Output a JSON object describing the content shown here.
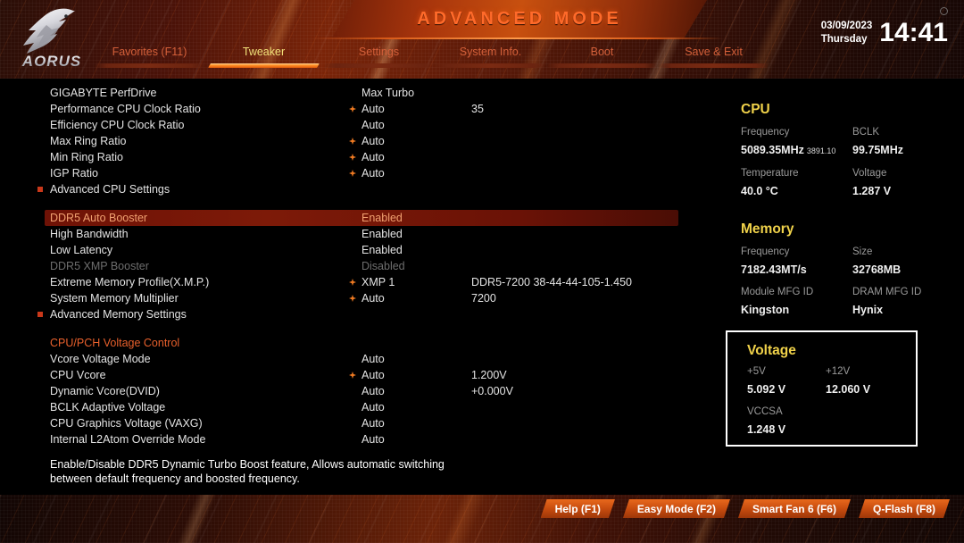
{
  "header": {
    "mode_title": "ADVANCED MODE",
    "logo_text": "AORUS",
    "date": "03/09/2023",
    "weekday": "Thursday",
    "time": "14:41",
    "tabs": [
      {
        "label": "Favorites (F11)",
        "active": false
      },
      {
        "label": "Tweaker",
        "active": true
      },
      {
        "label": "Settings",
        "active": false
      },
      {
        "label": "System Info.",
        "active": false
      },
      {
        "label": "Boot",
        "active": false
      },
      {
        "label": "Save & Exit",
        "active": false
      }
    ]
  },
  "settings": [
    {
      "label": "GIGABYTE PerfDrive",
      "value": "Max Turbo",
      "value2": "",
      "star": false,
      "bullet": false,
      "dim": false,
      "section": false,
      "highlight": false
    },
    {
      "label": "Performance CPU Clock Ratio",
      "value": "Auto",
      "value2": "35",
      "star": true,
      "bullet": false,
      "dim": false,
      "section": false,
      "highlight": false
    },
    {
      "label": "Efficiency CPU Clock Ratio",
      "value": "Auto",
      "value2": "",
      "star": false,
      "bullet": false,
      "dim": false,
      "section": false,
      "highlight": false
    },
    {
      "label": "Max Ring Ratio",
      "value": "Auto",
      "value2": "",
      "star": true,
      "bullet": false,
      "dim": false,
      "section": false,
      "highlight": false
    },
    {
      "label": "Min Ring Ratio",
      "value": "Auto",
      "value2": "",
      "star": true,
      "bullet": false,
      "dim": false,
      "section": false,
      "highlight": false
    },
    {
      "label": "IGP Ratio",
      "value": "Auto",
      "value2": "",
      "star": true,
      "bullet": false,
      "dim": false,
      "section": false,
      "highlight": false
    },
    {
      "label": "Advanced CPU Settings",
      "value": "",
      "value2": "",
      "star": false,
      "bullet": true,
      "dim": false,
      "section": false,
      "highlight": false
    },
    {
      "label": "DDR5 Auto Booster",
      "value": "Enabled",
      "value2": "",
      "star": false,
      "bullet": false,
      "dim": false,
      "section": false,
      "highlight": true
    },
    {
      "label": "High Bandwidth",
      "value": "Enabled",
      "value2": "",
      "star": false,
      "bullet": false,
      "dim": false,
      "section": false,
      "highlight": false
    },
    {
      "label": "Low Latency",
      "value": "Enabled",
      "value2": "",
      "star": false,
      "bullet": false,
      "dim": false,
      "section": false,
      "highlight": false
    },
    {
      "label": "DDR5 XMP Booster",
      "value": "Disabled",
      "value2": "",
      "star": false,
      "bullet": false,
      "dim": true,
      "section": false,
      "highlight": false
    },
    {
      "label": "Extreme Memory Profile(X.M.P.)",
      "value": "XMP 1",
      "value2": "DDR5-7200 38-44-44-105-1.450",
      "star": true,
      "bullet": false,
      "dim": false,
      "section": false,
      "highlight": false
    },
    {
      "label": "System Memory Multiplier",
      "value": "Auto",
      "value2": "7200",
      "star": true,
      "bullet": false,
      "dim": false,
      "section": false,
      "highlight": false
    },
    {
      "label": "Advanced Memory Settings",
      "value": "",
      "value2": "",
      "star": false,
      "bullet": true,
      "dim": false,
      "section": false,
      "highlight": false
    },
    {
      "label": "CPU/PCH Voltage Control",
      "value": "",
      "value2": "",
      "star": false,
      "bullet": false,
      "dim": false,
      "section": true,
      "highlight": false
    },
    {
      "label": "Vcore Voltage Mode",
      "value": "Auto",
      "value2": "",
      "star": false,
      "bullet": false,
      "dim": false,
      "section": false,
      "highlight": false
    },
    {
      "label": "CPU Vcore",
      "value": "Auto",
      "value2": "1.200V",
      "star": true,
      "bullet": false,
      "dim": false,
      "section": false,
      "highlight": false
    },
    {
      "label": "Dynamic Vcore(DVID)",
      "value": "Auto",
      "value2": "+0.000V",
      "star": false,
      "bullet": false,
      "dim": false,
      "section": false,
      "highlight": false
    },
    {
      "label": "BCLK Adaptive Voltage",
      "value": "Auto",
      "value2": "",
      "star": false,
      "bullet": false,
      "dim": false,
      "section": false,
      "highlight": false
    },
    {
      "label": "CPU Graphics Voltage (VAXG)",
      "value": "Auto",
      "value2": "",
      "star": false,
      "bullet": false,
      "dim": false,
      "section": false,
      "highlight": false
    },
    {
      "label": "Internal L2Atom Override Mode",
      "value": "Auto",
      "value2": "",
      "star": false,
      "bullet": false,
      "dim": false,
      "section": false,
      "highlight": false
    }
  ],
  "panels": {
    "cpu": {
      "title": "CPU",
      "freq_key": "Frequency",
      "freq_val": "5089.35MHz",
      "freq_sub": "3891.10",
      "bclk_key": "BCLK",
      "bclk_val": "99.75MHz",
      "temp_key": "Temperature",
      "temp_val": "40.0 °C",
      "volt_key": "Voltage",
      "volt_val": "1.287 V"
    },
    "memory": {
      "title": "Memory",
      "freq_key": "Frequency",
      "freq_val": "7182.43MT/s",
      "size_key": "Size",
      "size_val": "32768MB",
      "modmfg_key": "Module MFG ID",
      "modmfg_val": "Kingston",
      "drammfg_key": "DRAM MFG ID",
      "drammfg_val": "Hynix"
    },
    "voltage": {
      "title": "Voltage",
      "v5_key": "+5V",
      "v5_val": "5.092 V",
      "v12_key": "+12V",
      "v12_val": "12.060 V",
      "vccsa_key": "VCCSA",
      "vccsa_val": "1.248 V"
    }
  },
  "help": {
    "line1": "Enable/Disable DDR5 Dynamic Turbo Boost feature, Allows automatic switching",
    "line2": "between default frequency and boosted frequency."
  },
  "footer": {
    "buttons": [
      {
        "label": "Help (F1)"
      },
      {
        "label": "Easy Mode (F2)"
      },
      {
        "label": "Smart Fan 6 (F6)"
      },
      {
        "label": "Q-Flash (F8)"
      }
    ]
  },
  "colors": {
    "accent_orange": "#e8602c",
    "active_tab": "#f2e27a",
    "panel_title": "#f0d24a",
    "highlight_bg": "#7d1a08"
  }
}
